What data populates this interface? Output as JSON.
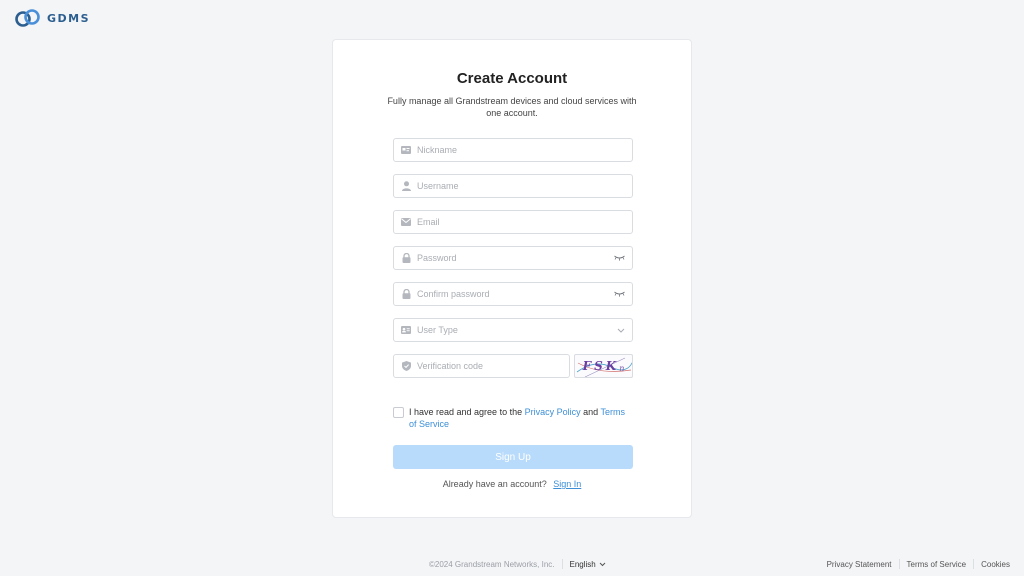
{
  "header": {
    "logo_text": "GDMS"
  },
  "card": {
    "title": "Create Account",
    "subtitle": "Fully manage all Grandstream devices and cloud services with one account."
  },
  "form": {
    "nickname_placeholder": "Nickname",
    "username_placeholder": "Username",
    "email_placeholder": "Email",
    "password_placeholder": "Password",
    "confirm_password_placeholder": "Confirm password",
    "user_type_placeholder": "User Type",
    "verification_placeholder": "Verification code",
    "captcha_text": "FSK",
    "captcha_small": "n"
  },
  "agreement": {
    "prefix": "I have read and agree to the",
    "privacy_link": "Privacy Policy",
    "and": "and",
    "terms_link": "Terms of Service",
    "checked": false
  },
  "signup_button": "Sign Up",
  "signin": {
    "prompt": "Already have an account?",
    "link": "Sign In"
  },
  "footer": {
    "copyright": "©2024 Grandstream Networks, Inc.",
    "language": "English",
    "privacy_statement": "Privacy Statement",
    "terms_of_service": "Terms of Service",
    "cookies": "Cookies"
  },
  "colors": {
    "accent": "#3d8fd8",
    "button_disabled": "#b9dbfb",
    "icon": "#b4b8be",
    "brand": "#2c5f8f"
  },
  "icons": {
    "nickname": "id-card-icon",
    "username": "user-icon",
    "email": "envelope-icon",
    "password": "lock-icon",
    "confirm": "lock-icon",
    "user_type": "badge-icon",
    "verification": "shield-icon",
    "eye": "eye-closed-icon",
    "dropdown": "chevron-down-icon"
  }
}
